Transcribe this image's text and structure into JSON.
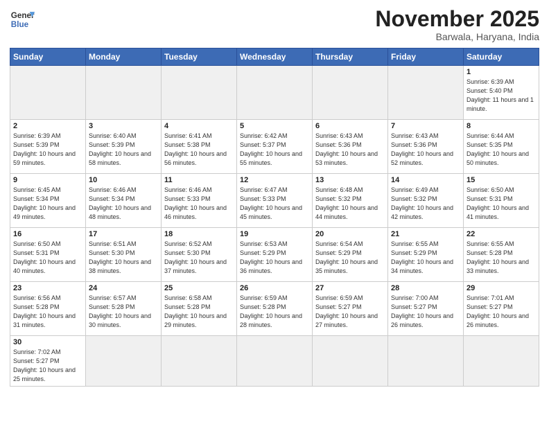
{
  "header": {
    "logo_general": "General",
    "logo_blue": "Blue",
    "title": "November 2025",
    "subtitle": "Barwala, Haryana, India"
  },
  "days_of_week": [
    "Sunday",
    "Monday",
    "Tuesday",
    "Wednesday",
    "Thursday",
    "Friday",
    "Saturday"
  ],
  "weeks": [
    [
      {
        "num": "",
        "info": "",
        "empty": true
      },
      {
        "num": "",
        "info": "",
        "empty": true
      },
      {
        "num": "",
        "info": "",
        "empty": true
      },
      {
        "num": "",
        "info": "",
        "empty": true
      },
      {
        "num": "",
        "info": "",
        "empty": true
      },
      {
        "num": "",
        "info": "",
        "empty": true
      },
      {
        "num": "1",
        "info": "Sunrise: 6:39 AM\nSunset: 5:40 PM\nDaylight: 11 hours\nand 1 minute.",
        "empty": false
      }
    ],
    [
      {
        "num": "2",
        "info": "Sunrise: 6:39 AM\nSunset: 5:39 PM\nDaylight: 10 hours\nand 59 minutes.",
        "empty": false
      },
      {
        "num": "3",
        "info": "Sunrise: 6:40 AM\nSunset: 5:39 PM\nDaylight: 10 hours\nand 58 minutes.",
        "empty": false
      },
      {
        "num": "4",
        "info": "Sunrise: 6:41 AM\nSunset: 5:38 PM\nDaylight: 10 hours\nand 56 minutes.",
        "empty": false
      },
      {
        "num": "5",
        "info": "Sunrise: 6:42 AM\nSunset: 5:37 PM\nDaylight: 10 hours\nand 55 minutes.",
        "empty": false
      },
      {
        "num": "6",
        "info": "Sunrise: 6:43 AM\nSunset: 5:36 PM\nDaylight: 10 hours\nand 53 minutes.",
        "empty": false
      },
      {
        "num": "7",
        "info": "Sunrise: 6:43 AM\nSunset: 5:36 PM\nDaylight: 10 hours\nand 52 minutes.",
        "empty": false
      },
      {
        "num": "8",
        "info": "Sunrise: 6:44 AM\nSunset: 5:35 PM\nDaylight: 10 hours\nand 50 minutes.",
        "empty": false
      }
    ],
    [
      {
        "num": "9",
        "info": "Sunrise: 6:45 AM\nSunset: 5:34 PM\nDaylight: 10 hours\nand 49 minutes.",
        "empty": false
      },
      {
        "num": "10",
        "info": "Sunrise: 6:46 AM\nSunset: 5:34 PM\nDaylight: 10 hours\nand 48 minutes.",
        "empty": false
      },
      {
        "num": "11",
        "info": "Sunrise: 6:46 AM\nSunset: 5:33 PM\nDaylight: 10 hours\nand 46 minutes.",
        "empty": false
      },
      {
        "num": "12",
        "info": "Sunrise: 6:47 AM\nSunset: 5:33 PM\nDaylight: 10 hours\nand 45 minutes.",
        "empty": false
      },
      {
        "num": "13",
        "info": "Sunrise: 6:48 AM\nSunset: 5:32 PM\nDaylight: 10 hours\nand 44 minutes.",
        "empty": false
      },
      {
        "num": "14",
        "info": "Sunrise: 6:49 AM\nSunset: 5:32 PM\nDaylight: 10 hours\nand 42 minutes.",
        "empty": false
      },
      {
        "num": "15",
        "info": "Sunrise: 6:50 AM\nSunset: 5:31 PM\nDaylight: 10 hours\nand 41 minutes.",
        "empty": false
      }
    ],
    [
      {
        "num": "16",
        "info": "Sunrise: 6:50 AM\nSunset: 5:31 PM\nDaylight: 10 hours\nand 40 minutes.",
        "empty": false
      },
      {
        "num": "17",
        "info": "Sunrise: 6:51 AM\nSunset: 5:30 PM\nDaylight: 10 hours\nand 38 minutes.",
        "empty": false
      },
      {
        "num": "18",
        "info": "Sunrise: 6:52 AM\nSunset: 5:30 PM\nDaylight: 10 hours\nand 37 minutes.",
        "empty": false
      },
      {
        "num": "19",
        "info": "Sunrise: 6:53 AM\nSunset: 5:29 PM\nDaylight: 10 hours\nand 36 minutes.",
        "empty": false
      },
      {
        "num": "20",
        "info": "Sunrise: 6:54 AM\nSunset: 5:29 PM\nDaylight: 10 hours\nand 35 minutes.",
        "empty": false
      },
      {
        "num": "21",
        "info": "Sunrise: 6:55 AM\nSunset: 5:29 PM\nDaylight: 10 hours\nand 34 minutes.",
        "empty": false
      },
      {
        "num": "22",
        "info": "Sunrise: 6:55 AM\nSunset: 5:28 PM\nDaylight: 10 hours\nand 33 minutes.",
        "empty": false
      }
    ],
    [
      {
        "num": "23",
        "info": "Sunrise: 6:56 AM\nSunset: 5:28 PM\nDaylight: 10 hours\nand 31 minutes.",
        "empty": false
      },
      {
        "num": "24",
        "info": "Sunrise: 6:57 AM\nSunset: 5:28 PM\nDaylight: 10 hours\nand 30 minutes.",
        "empty": false
      },
      {
        "num": "25",
        "info": "Sunrise: 6:58 AM\nSunset: 5:28 PM\nDaylight: 10 hours\nand 29 minutes.",
        "empty": false
      },
      {
        "num": "26",
        "info": "Sunrise: 6:59 AM\nSunset: 5:28 PM\nDaylight: 10 hours\nand 28 minutes.",
        "empty": false
      },
      {
        "num": "27",
        "info": "Sunrise: 6:59 AM\nSunset: 5:27 PM\nDaylight: 10 hours\nand 27 minutes.",
        "empty": false
      },
      {
        "num": "28",
        "info": "Sunrise: 7:00 AM\nSunset: 5:27 PM\nDaylight: 10 hours\nand 26 minutes.",
        "empty": false
      },
      {
        "num": "29",
        "info": "Sunrise: 7:01 AM\nSunset: 5:27 PM\nDaylight: 10 hours\nand 26 minutes.",
        "empty": false
      }
    ],
    [
      {
        "num": "30",
        "info": "Sunrise: 7:02 AM\nSunset: 5:27 PM\nDaylight: 10 hours\nand 25 minutes.",
        "empty": false,
        "last": true
      },
      {
        "num": "",
        "info": "",
        "empty": true,
        "last": true
      },
      {
        "num": "",
        "info": "",
        "empty": true,
        "last": true
      },
      {
        "num": "",
        "info": "",
        "empty": true,
        "last": true
      },
      {
        "num": "",
        "info": "",
        "empty": true,
        "last": true
      },
      {
        "num": "",
        "info": "",
        "empty": true,
        "last": true
      },
      {
        "num": "",
        "info": "",
        "empty": true,
        "last": true
      }
    ]
  ]
}
